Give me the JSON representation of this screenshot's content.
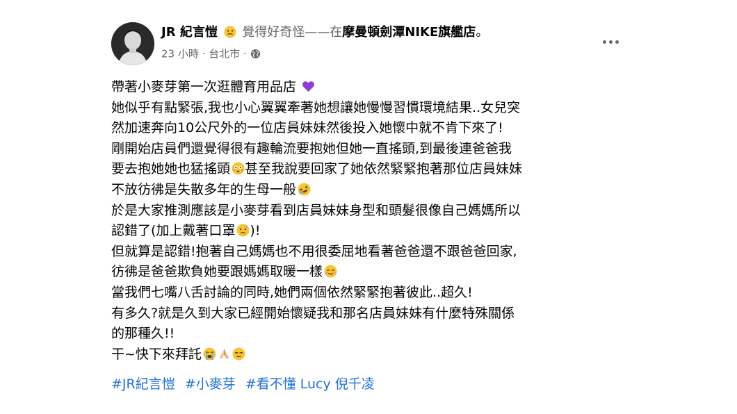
{
  "post": {
    "author": {
      "name": "JR 紀言愷",
      "feeling_text": "覺得好奇怪——在",
      "place": "摩曼頓劍潭NIKE旗艦店",
      "end_mark": "。"
    },
    "meta": {
      "time": "23 小時",
      "separator": "·",
      "location": "台北市",
      "separator2": "·",
      "privacy_icon": "globe-icon"
    },
    "body_lines": [
      "帶著小麥芽第一次逛體育用品店",
      "她似乎有點緊張,我也小心翼翼牽著她想讓她慢慢習慣環境結果..女兒突",
      "然加速奔向10公尺外的一位店員妹妹然後投入她懷中就不肯下來了!",
      "剛開始店員們還覺得很有趣輪流要抱她但她一直搖頭,到最後連爸爸我",
      "要去抱她她也猛搖頭",
      "甚至我說要回家了她依然緊緊抱著那位店員妹妹",
      "不放彷彿是失散多年的生母一般",
      "於是大家推測應該是小麥芽看到店員妹妹身型和頭髮很像自己媽媽所以",
      "認錯了(加上戴著口罩",
      ")!",
      "但就算是認錯!抱著自己媽媽也不用很委屈地看著爸爸還不跟爸爸回家,",
      "彷彿是爸爸欺負她要跟媽媽取暖一樣",
      "當我們七嘴八舌討論的同時,她們兩個依然緊緊抱著彼此..超久!",
      "有多久?就是久到大家已經開始懷疑我和那名店員妹妹有什麼特殊關係",
      "的那種久!!",
      "干~快下來拜託"
    ],
    "hashtags": [
      "#JR紀言愷",
      "#小麥芽",
      "#看不懂 Lucy 倪千凌"
    ]
  },
  "colors": {
    "text": "#050505",
    "secondary": "#65676b",
    "link": "#216fdb",
    "purple_heart": "#8e3fd6",
    "emoji_yellow": "#f7c436"
  }
}
